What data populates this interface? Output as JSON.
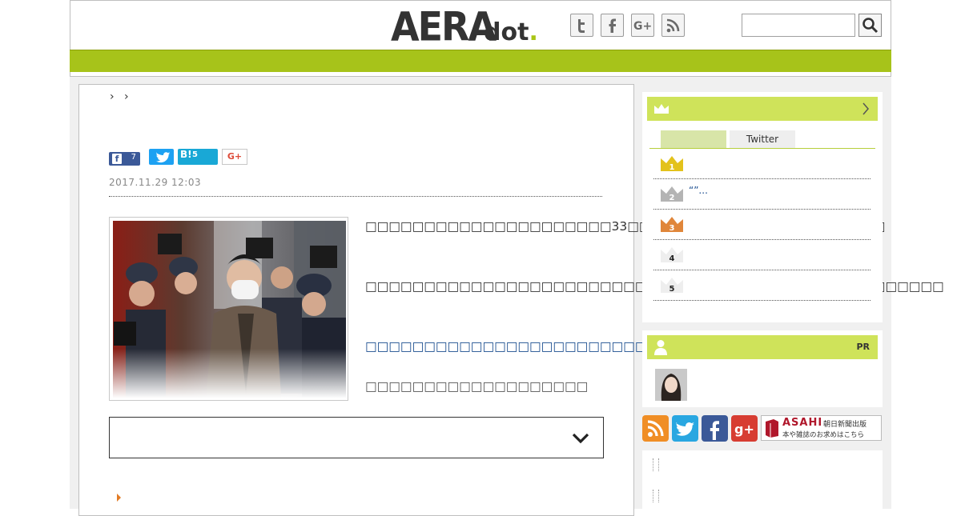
{
  "header": {
    "logo_main": "AERA",
    "logo_sub": "dot",
    "logo_period": ".",
    "sns_icons": [
      "twitter-icon",
      "facebook-icon",
      "google-plus-icon",
      "rss-icon"
    ],
    "search": {
      "placeholder": ""
    }
  },
  "colors": {
    "brand_green": "#a7c31a",
    "side_header_green": "#cfe35a",
    "link_blue": "#1a4d8f"
  },
  "article": {
    "breadcrumb_sep": "›",
    "share": {
      "facebook_count": "7",
      "hatena_label": "B!",
      "hatena_count": "5",
      "gplus_label": "G+"
    },
    "date": "2017.11.29 12:03",
    "paragraphs": [
      "□□□□□□□□□□□□□□□□□□□□□33□□□□□□□□□□□□□□□□□□□□□□",
      "□□□□□□□□□□□□□□□□□□□□□□□□□□□□□29□□□□□□□□□□□□□□□□□□□",
      "□□□□□□□□□□□□□□□□□□□□□□□□□□□□□□",
      "□□□□□□□□□□□□□□□□□□□"
    ]
  },
  "sidebar": {
    "ranking_tabs": [
      "",
      "Twitter"
    ],
    "ranking": [
      {
        "rank": "1",
        "text": ""
      },
      {
        "rank": "2",
        "text": "“”..."
      },
      {
        "rank": "3",
        "text": ""
      },
      {
        "rank": "4",
        "text": ""
      },
      {
        "rank": "5",
        "text": ""
      }
    ],
    "pr_label": "PR",
    "asahi_title": "ASAHI",
    "asahi_sub1": "朝日新聞出版",
    "asahi_sub2": "本や雑誌のお求めはこちら"
  }
}
